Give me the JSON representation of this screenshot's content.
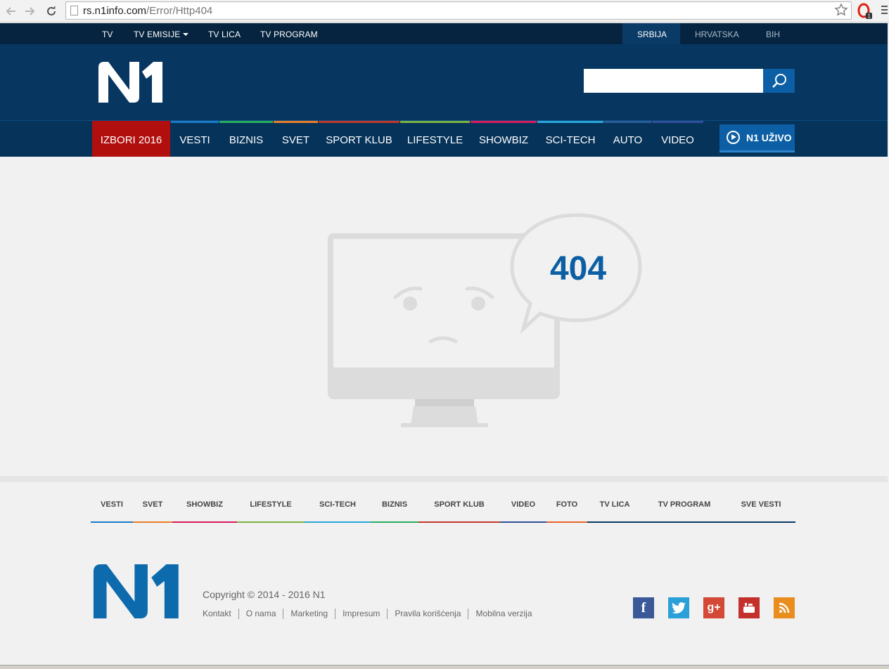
{
  "browser": {
    "url_host": "rs.n1info.com",
    "url_path": "/Error/Http404"
  },
  "topbar": {
    "links": [
      "TV",
      "TV EMISIJE",
      "TV LICA",
      "TV PROGRAM"
    ],
    "regions": [
      "SRBIJA",
      "HRVATSKA",
      "BIH"
    ],
    "active_region": "SRBIJA"
  },
  "header": {
    "logo": "N1",
    "search_placeholder": ""
  },
  "mainnav": {
    "items": [
      "IZBORI 2016",
      "VESTI",
      "BIZNIS",
      "SVET",
      "SPORT KLUB",
      "LIFESTYLE",
      "SHOWBIZ",
      "SCI-TECH",
      "AUTO",
      "VIDEO"
    ],
    "live_label": "N1 UŽIVO"
  },
  "error": {
    "code": "404"
  },
  "footer_nav": {
    "items": [
      "VESTI",
      "SVET",
      "SHOWBIZ",
      "LIFESTYLE",
      "SCI-TECH",
      "BIZNIS",
      "SPORT KLUB",
      "VIDEO",
      "FOTO",
      "TV LICA",
      "TV PROGRAM",
      "SVE VESTI"
    ]
  },
  "footer": {
    "copyright": "Copyright © 2014 - 2016 N1",
    "links": [
      "Kontakt",
      "O nama",
      "Marketing",
      "Impresum",
      "Pravila korišćenja",
      "Mobilna verzija"
    ],
    "social": [
      "facebook-icon",
      "twitter-icon",
      "google-plus-icon",
      "youtube-icon",
      "rss-icon"
    ]
  },
  "colors": {
    "brand_dark": "#06243f",
    "brand_header": "#073761",
    "brand_blue": "#0c5fa4",
    "izbori_red": "#b10e0e"
  }
}
